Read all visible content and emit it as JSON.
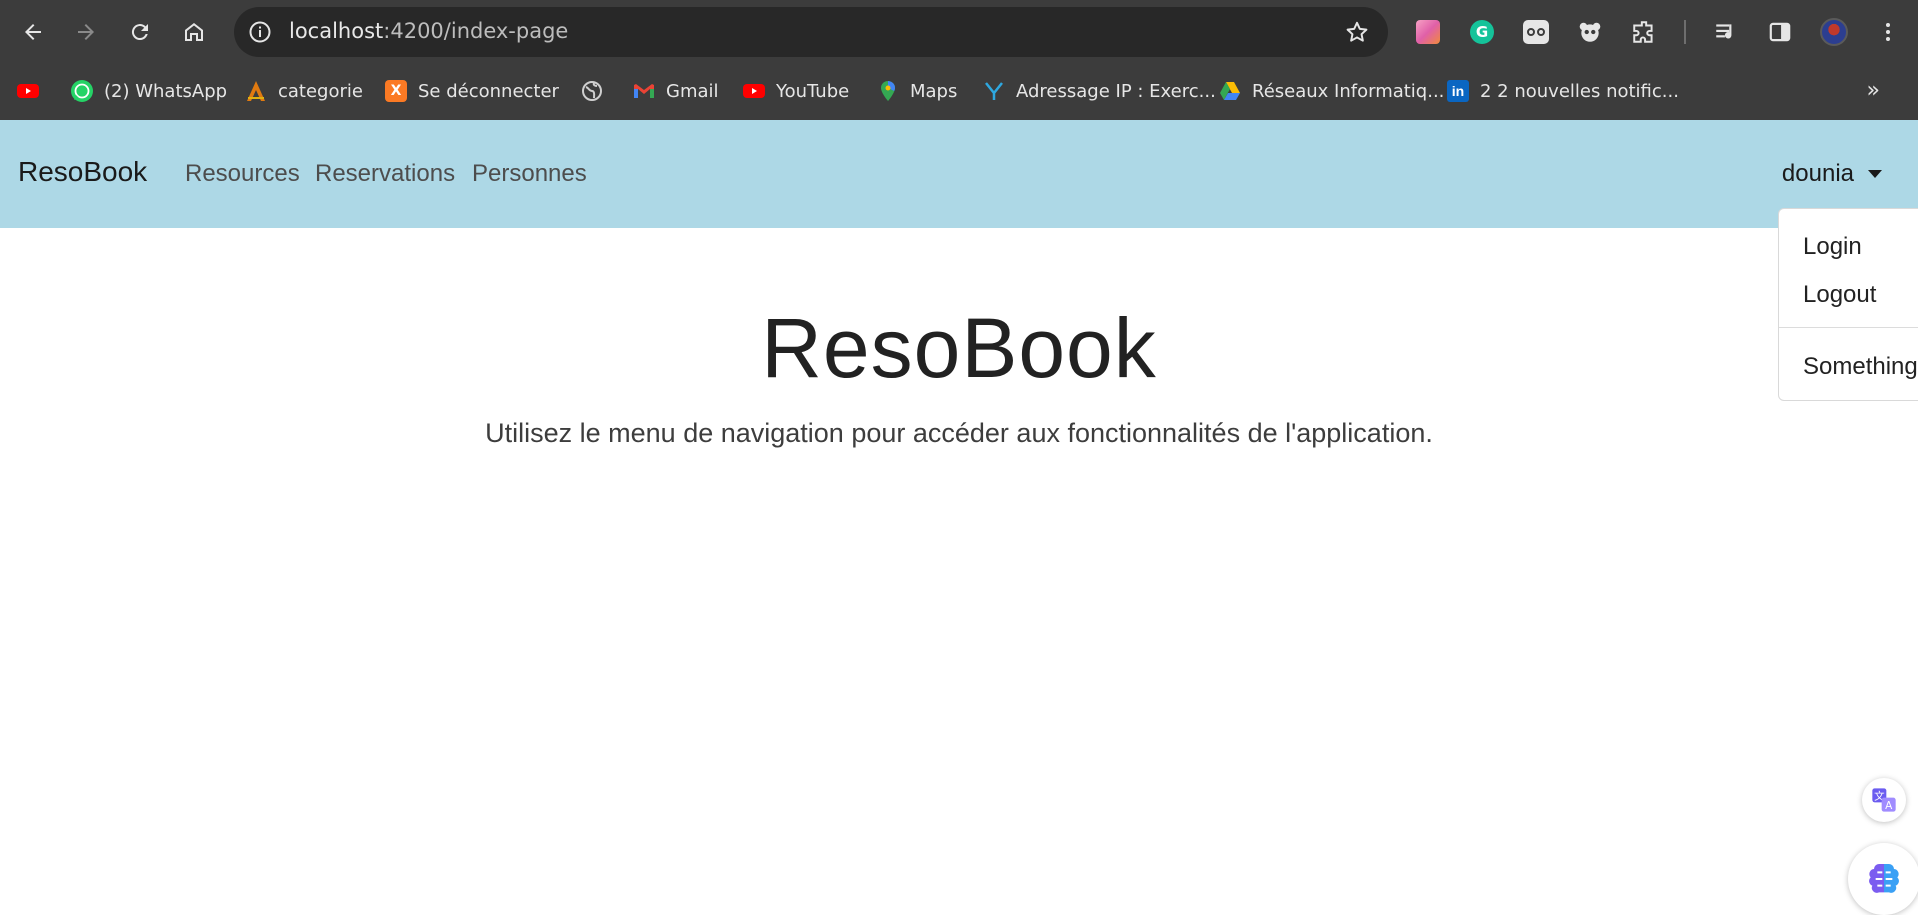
{
  "browser": {
    "url_host": "localhost",
    "url_path": ":4200/index-page",
    "bookmarks": [
      {
        "label": "",
        "icon": "youtube-icon"
      },
      {
        "label": "(2) WhatsApp",
        "icon": "whatsapp-icon"
      },
      {
        "label": "categorie",
        "icon": "categorie-icon"
      },
      {
        "label": "Se déconnecter",
        "icon": "xampp-icon"
      },
      {
        "label": "",
        "icon": "globe-icon"
      },
      {
        "label": "Gmail",
        "icon": "gmail-icon"
      },
      {
        "label": "YouTube",
        "icon": "youtube-icon"
      },
      {
        "label": "Maps",
        "icon": "maps-icon"
      },
      {
        "label": "Adressage IP : Exerc...",
        "icon": "adressage-icon"
      },
      {
        "label": "Réseaux Informatiq...",
        "icon": "google-drive-icon"
      },
      {
        "label": "2 2 nouvelles notific...",
        "icon": "linkedin-icon"
      }
    ],
    "more_bookmarks": "»"
  },
  "navbar": {
    "brand": "ResoBook",
    "links": [
      "Resources",
      "Reservations",
      "Personnes"
    ],
    "user": "dounia",
    "background": "#add8e6"
  },
  "dropdown": {
    "items": [
      "Login",
      "Logout"
    ],
    "extra_item": "Something"
  },
  "hero": {
    "title": "ResoBook",
    "subtitle": "Utilisez le menu de navigation pour accéder aux fonctionnalités de l'application."
  }
}
